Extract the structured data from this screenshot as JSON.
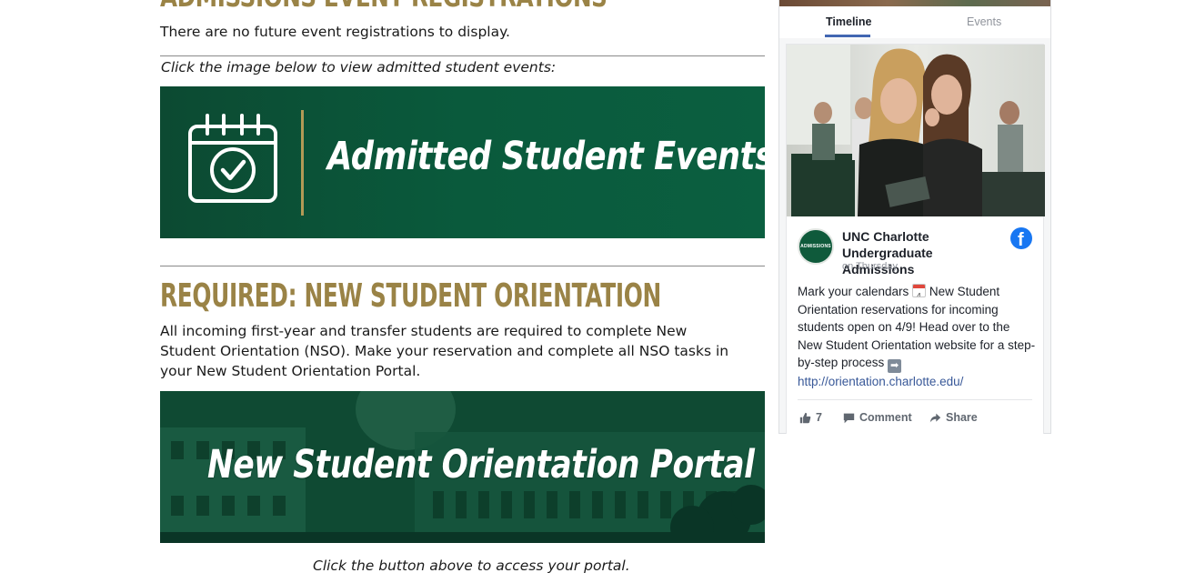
{
  "main": {
    "event_heading": "Admissions Event Registrations",
    "no_registrations_text": "There are no future event registrations to display.",
    "click_events_text": "Click the image below to view admitted student events:",
    "events_banner_title": "Admitted Student Events",
    "nso_heading": "REQUIRED: NEW STUDENT ORIENTATION",
    "nso_body": "All incoming first-year and transfer students are required to complete New Student Orientation (NSO). Make your reservation and complete all NSO tasks in your New Student Orientation Portal.",
    "portal_banner_title": "New Student Orientation Portal",
    "click_portal_text": "Click the button above to access your portal."
  },
  "facebook": {
    "tabs": [
      {
        "label": "Timeline",
        "active": true
      },
      {
        "label": "Events",
        "active": false
      }
    ],
    "avatar_text": "ADMISSIONS",
    "page_name": "UNC Charlotte Undergraduate Admissions",
    "post_time": "on Thursday",
    "post_text_1": "Mark your calendars",
    "calendar_emoji_day": "4",
    "post_text_2": "New Student Orientation reservations for incoming students open on 4/9! Head over to the New Student Orientation website for a step-by-step process",
    "post_link": "http://orientation.charlotte.edu/",
    "like_count": "7",
    "comment_label": "Comment",
    "share_label": "Share",
    "logo_letter": "f"
  },
  "colors": {
    "gold": "#9a8346",
    "green": "#0b5a3c",
    "fb_blue": "#4267b2",
    "link": "#385898"
  },
  "icons": [
    "calendar-check-icon",
    "facebook-logo-icon",
    "like-icon",
    "comment-icon",
    "share-icon",
    "calendar-emoji-icon",
    "right-arrow-emoji-icon"
  ]
}
